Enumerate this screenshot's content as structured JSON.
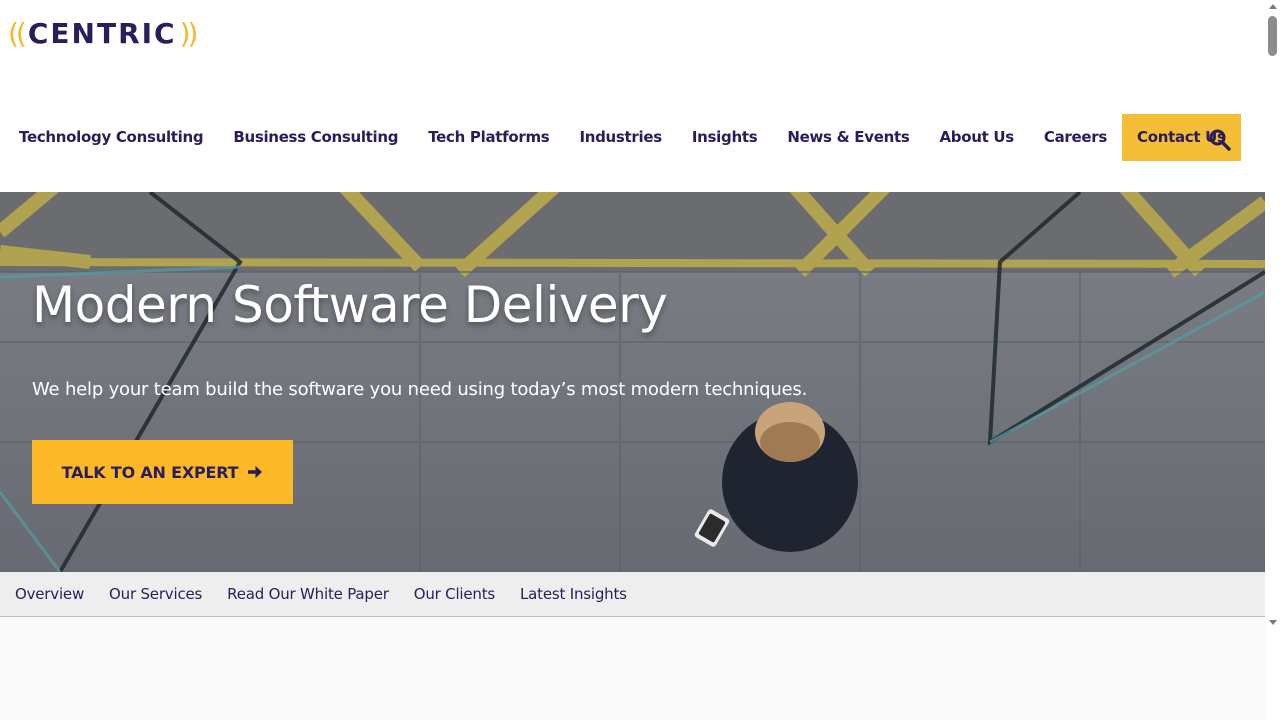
{
  "brand": {
    "logo_left_paren": "((",
    "logo_word": "CENTRIC",
    "logo_right_paren": "))",
    "primary_color": "#2a1d5c",
    "accent_color": "#f3bd35"
  },
  "main_nav": {
    "items": [
      {
        "label": "Technology Consulting"
      },
      {
        "label": "Business Consulting"
      },
      {
        "label": "Tech Platforms"
      },
      {
        "label": "Industries"
      },
      {
        "label": "Insights"
      },
      {
        "label": "News & Events"
      },
      {
        "label": "About Us"
      },
      {
        "label": "Careers"
      }
    ],
    "contact_label": "Contact Us",
    "search_icon": "search-icon"
  },
  "hero": {
    "title": "Modern Software Delivery",
    "subtitle": "We help your team build the software you need using today’s most modern techniques.",
    "cta_label": "TALK TO AN EXPERT",
    "cta_icon": "arrow-right-icon",
    "cta_color": "#fbb827"
  },
  "sub_nav": {
    "items": [
      {
        "label": "Overview"
      },
      {
        "label": "Our Services"
      },
      {
        "label": "Read Our White Paper"
      },
      {
        "label": "Our Clients"
      },
      {
        "label": "Latest Insights"
      }
    ]
  }
}
